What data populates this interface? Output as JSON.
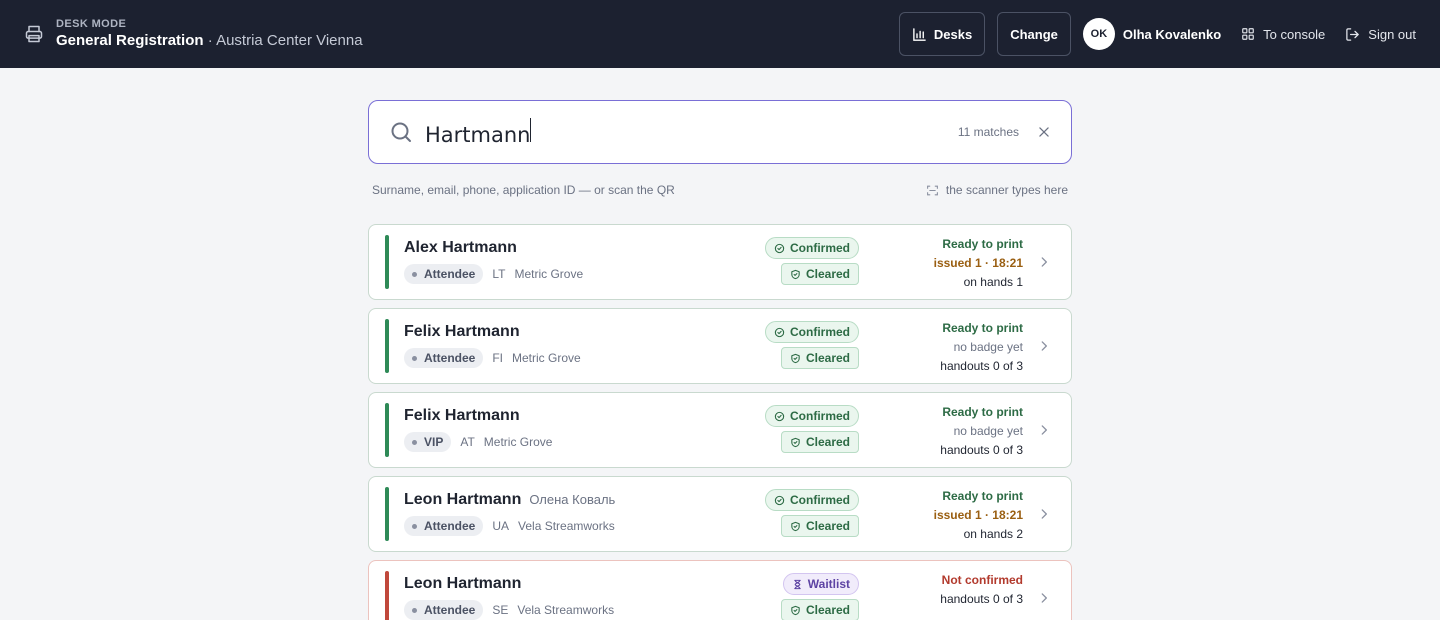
{
  "header": {
    "mode_label": "DESK MODE",
    "event_name": "General Registration",
    "separator": " · ",
    "venue": "Austria Center Vienna",
    "desks_label": "Desks",
    "change_label": "Change",
    "user_initials": "OK",
    "user_name": "Olha Kovalenko",
    "console_label": "To console",
    "signout_label": "Sign out"
  },
  "search": {
    "query": "Hartmann",
    "match_count": "11 matches",
    "hint": "Surname, email, phone, application ID — or scan the QR",
    "scanner_hint": "the scanner types here"
  },
  "results": [
    {
      "name": "Alex Hartmann",
      "alt_name": "",
      "role": "Attendee",
      "country": "LT",
      "org": "Metric Grove",
      "status_pill": "Confirmed",
      "clearance": "Cleared",
      "print_status": "Ready to print",
      "line2": "issued 1 · 18:21",
      "line3": "on hands 1"
    },
    {
      "name": "Felix Hartmann",
      "alt_name": "",
      "role": "Attendee",
      "country": "FI",
      "org": "Metric Grove",
      "status_pill": "Confirmed",
      "clearance": "Cleared",
      "print_status": "Ready to print",
      "line2": "no badge yet",
      "line3": "handouts 0 of 3"
    },
    {
      "name": "Felix Hartmann",
      "alt_name": "",
      "role": "VIP",
      "country": "AT",
      "org": "Metric Grove",
      "status_pill": "Confirmed",
      "clearance": "Cleared",
      "print_status": "Ready to print",
      "line2": "no badge yet",
      "line3": "handouts 0 of 3"
    },
    {
      "name": "Leon Hartmann",
      "alt_name": "Олена Коваль",
      "role": "Attendee",
      "country": "UA",
      "org": "Vela Streamworks",
      "status_pill": "Confirmed",
      "clearance": "Cleared",
      "print_status": "Ready to print",
      "line2": "issued 1 · 18:21",
      "line3": "on hands 2"
    },
    {
      "name": "Leon Hartmann",
      "alt_name": "",
      "role": "Attendee",
      "country": "SE",
      "org": "Vela Streamworks",
      "status_pill": "Waitlist",
      "clearance": "Cleared",
      "print_status": "Not confirmed",
      "line2": "handouts 0 of 3",
      "line3": ""
    }
  ],
  "colors": {
    "topbar_bg": "#1c2130",
    "accent_border": "#7a6fd6",
    "confirmed_stripe": "#2e8a57",
    "waitlist_stripe": "#c0483b",
    "ready_text": "#2d6b45",
    "issued_text": "#9a5f12",
    "not_confirmed_text": "#b23a2d"
  },
  "icons": [
    "printer-icon",
    "bar-chart-icon",
    "grid-icon",
    "sign-out-icon",
    "search-icon",
    "close-icon",
    "scan-icon",
    "check-circle-icon",
    "shield-check-icon",
    "hourglass-icon",
    "chevron-right-icon"
  ]
}
